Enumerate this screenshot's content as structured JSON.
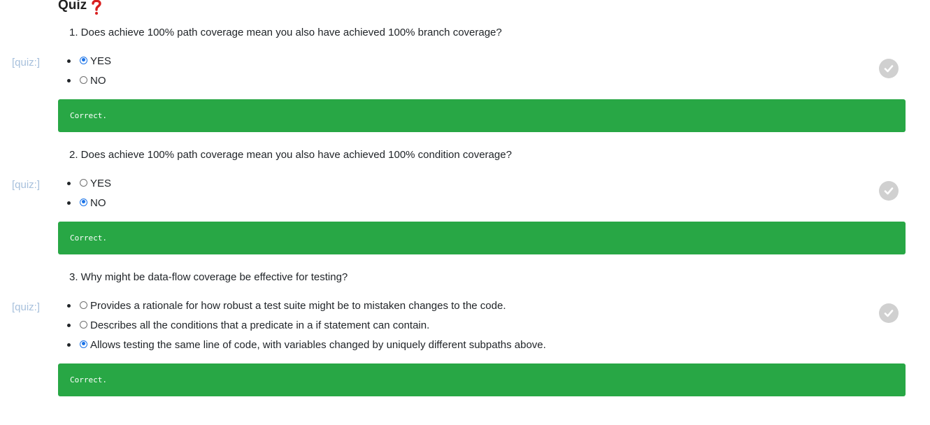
{
  "page": {
    "title": "Quiz"
  },
  "quizzes": [
    {
      "tag": "[quiz:]",
      "question": "1. Does achieve 100% path coverage mean you also have achieved 100% branch coverage?",
      "options": [
        {
          "label": "YES",
          "selected": true
        },
        {
          "label": "NO",
          "selected": false
        }
      ],
      "feedback": "Correct."
    },
    {
      "tag": "[quiz:]",
      "question": "2. Does achieve 100% path coverage mean you also have achieved 100% condition coverage?",
      "options": [
        {
          "label": "YES",
          "selected": false
        },
        {
          "label": "NO",
          "selected": true
        }
      ],
      "feedback": "Correct."
    },
    {
      "tag": "[quiz:]",
      "question": "3. Why might be data-flow coverage be effective for testing?",
      "options": [
        {
          "label": "Provides a rationale for how robust a test suite might be to mistaken changes to the code.",
          "selected": false
        },
        {
          "label": "Describes all the conditions that a predicate in a if statement can contain.",
          "selected": false
        },
        {
          "label": "Allows testing the same line of code, with variables changed by uniquely different subpaths above.",
          "selected": true
        }
      ],
      "feedback": "Correct."
    }
  ],
  "colors": {
    "feedback_bg": "#28a745",
    "tag": "#a7c0dc",
    "check_bg": "#d0d0d0",
    "radio_selected": "#1a73e8"
  },
  "icons": {
    "title_icon": "question-mark-icon",
    "check_icon": "checkmark-icon"
  }
}
